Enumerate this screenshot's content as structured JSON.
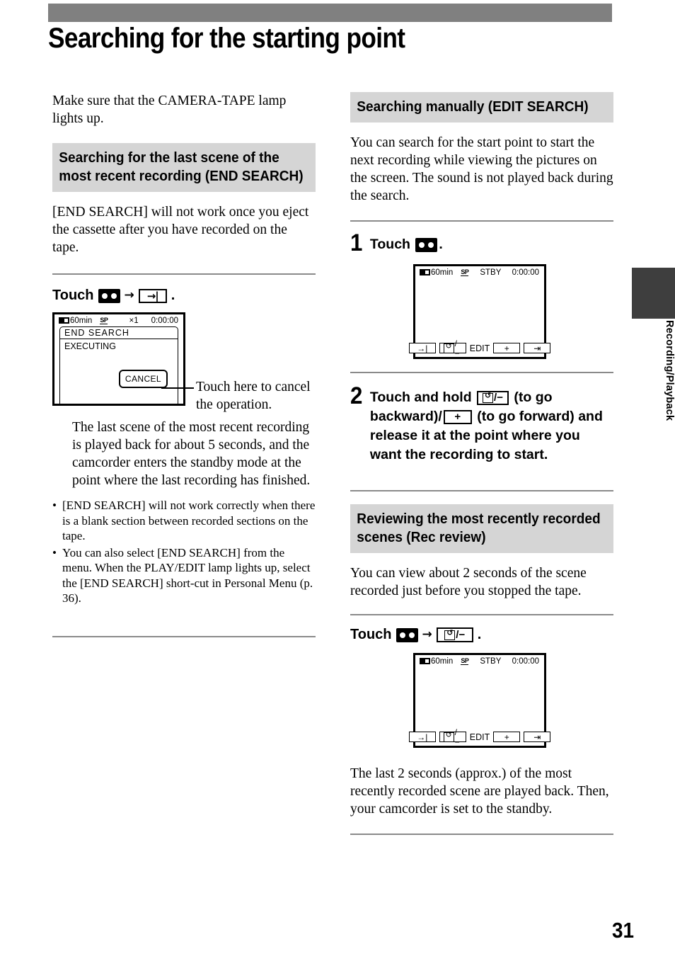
{
  "page": {
    "title": "Searching for the starting point",
    "number": "31",
    "side_tab_label": "Recording/Playback"
  },
  "left": {
    "intro": "Make sure that the CAMERA-TAPE lamp lights up.",
    "section_heading": "Searching for the last scene of the most recent recording (END SEARCH)",
    "section_body": "[END SEARCH] will not work once you eject the cassette after you have recorded on the tape.",
    "touch_label": "Touch",
    "touch_icons": [
      "tape-icon",
      "end-search-icon"
    ],
    "touch_period": ".",
    "lcd": {
      "battery": "60min",
      "speed": "SP",
      "zoom": "×1",
      "counter": "0:00:00",
      "menu_title": "END SEARCH",
      "menu_body": "EXECUTING",
      "cancel_label": "CANCEL"
    },
    "callout": "Touch here to cancel the operation.",
    "result_text": "The last scene of the most recent recording is played back for about 5 seconds, and the camcorder enters the standby mode at the point where the last recording has finished.",
    "notes": [
      "[END SEARCH] will not work correctly when there is a blank section between recorded sections on the tape.",
      "You can also select [END SEARCH] from the menu. When the PLAY/EDIT lamp lights up, select the [END SEARCH] short-cut in Personal Menu (p. 36)."
    ]
  },
  "right": {
    "section1_heading": "Searching manually (EDIT SEARCH)",
    "section1_body": "You can search for the start point to start the next recording while viewing the pictures on the screen. The sound is not played back during the search.",
    "step1": {
      "number": "1",
      "text_before": "Touch",
      "icon": "tape-icon",
      "text_after": "."
    },
    "step1_lcd": {
      "battery": "60min",
      "speed": "SP",
      "mode": "STBY",
      "counter": "0:00:00",
      "buttons": [
        "end-search-icon",
        "rec-review-icon",
        "EDIT",
        "+",
        "return-icon"
      ]
    },
    "step2": {
      "number": "2",
      "line1_a": "Touch and hold",
      "icon1": "rec-review-icon",
      "line1_b": "(to go",
      "line2_a": "backward)/",
      "icon2": "plus-icon",
      "line2_b": "(to go forward)",
      "line3": "and release it at the point where",
      "line4": "you want the recording to start."
    },
    "section2_heading": "Reviewing the most recently recorded scenes (Rec review)",
    "section2_body": "You can view about 2 seconds of the scene recorded just before you stopped the tape.",
    "touch_label": "Touch",
    "touch_icons": [
      "tape-icon",
      "rec-review-icon"
    ],
    "touch_period": ".",
    "step3_lcd": {
      "battery": "60min",
      "speed": "SP",
      "mode": "STBY",
      "counter": "0:00:00",
      "buttons": [
        "end-search-icon",
        "rec-review-icon",
        "EDIT",
        "+",
        "return-icon"
      ]
    },
    "closing_text": "The last 2 seconds (approx.) of the most recently recorded scene are played back. Then, your camcorder is set to the standby."
  },
  "labels": {
    "edit": "EDIT",
    "plus": "+",
    "slash_minus": "/−"
  },
  "colors": {
    "top_bar": "#808080",
    "heading_band": "#d5d5d5",
    "rule": "#8a8a8a",
    "side_tab": "#3e3e3e"
  }
}
